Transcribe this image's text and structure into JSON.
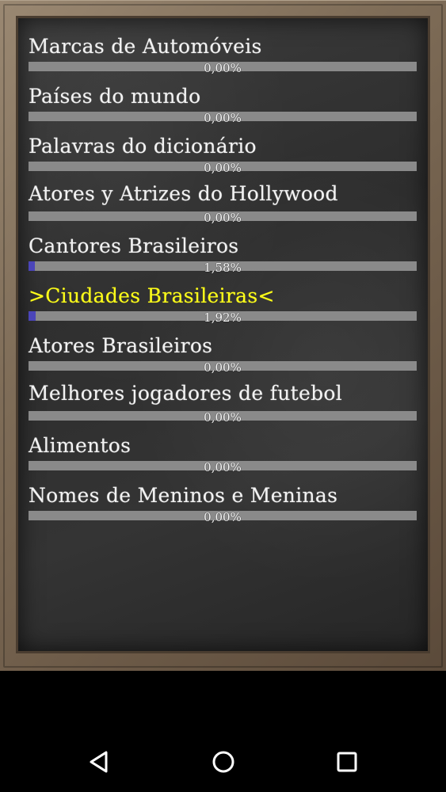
{
  "categories": [
    {
      "title": "Marcas de Automóveis",
      "percent_text": "0,00%",
      "progress": 0.0
    },
    {
      "title": "Países do mundo",
      "percent_text": "0,00%",
      "progress": 0.0
    },
    {
      "title": "Palavras do dicionário",
      "percent_text": "0,00%",
      "progress": 0.0
    },
    {
      "title": "Atores y Atrizes do Hollywood",
      "percent_text": "0,00%",
      "progress": 0.0
    },
    {
      "title": "Cantores Brasileiros",
      "percent_text": "1,58%",
      "progress": 1.58
    },
    {
      "title": ">Ciudades Brasileiras<",
      "percent_text": "1,92%",
      "progress": 1.92,
      "selected": true
    },
    {
      "title": "Atores Brasileiros",
      "percent_text": "0,00%",
      "progress": 0.0
    },
    {
      "title": "Melhores jogadores de futebol",
      "percent_text": "0,00%",
      "progress": 0.0
    },
    {
      "title": "Alimentos",
      "percent_text": "0,00%",
      "progress": 0.0
    },
    {
      "title": "Nomes de Meninos e Meninas",
      "percent_text": "0,00%",
      "progress": 0.0
    }
  ],
  "navbar": {
    "back_icon": "back-triangle-icon",
    "home_icon": "home-circle-icon",
    "recents_icon": "recents-square-icon"
  },
  "colors": {
    "selected_title": "#ffff1a",
    "normal_title": "#f2f2f2",
    "progress_track": "#8a8a8a",
    "progress_fill": "#4b45b9",
    "board": "#2f2f2f",
    "frame": "#7f6d58"
  }
}
